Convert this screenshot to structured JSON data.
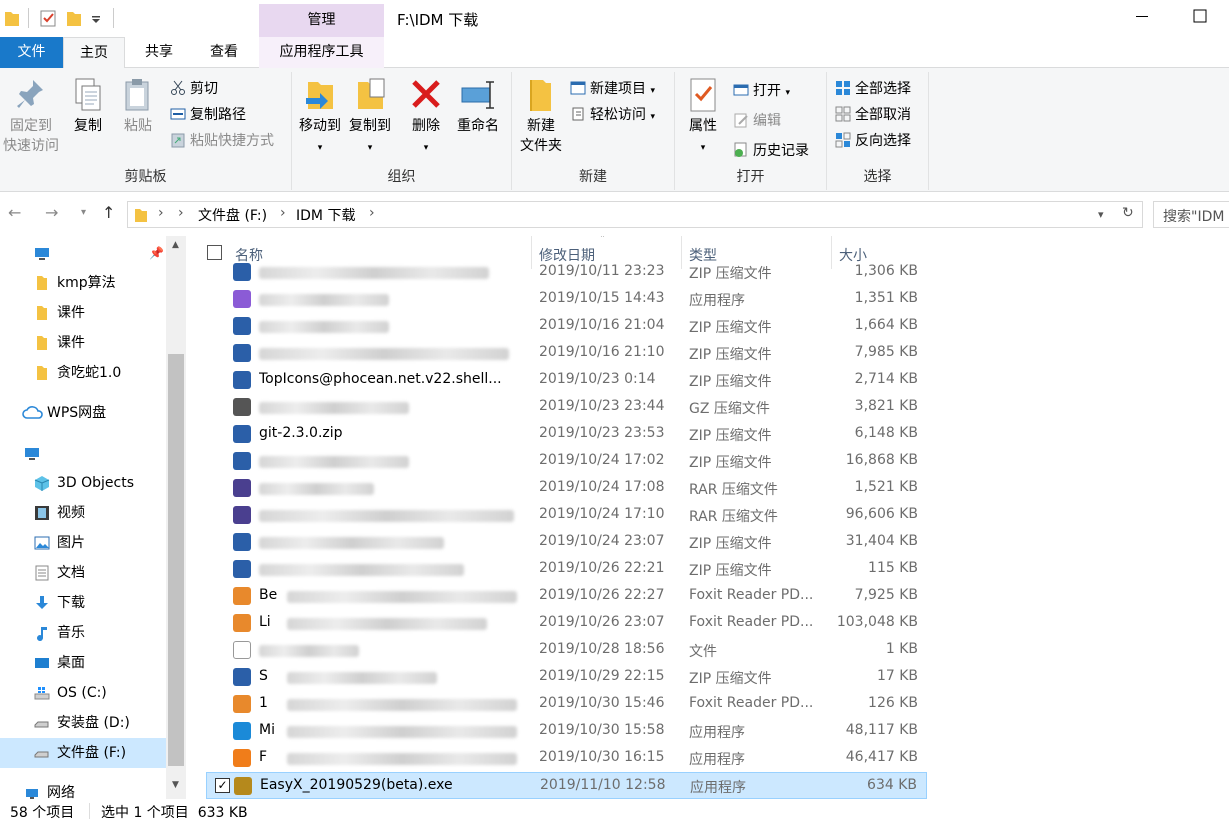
{
  "title": {
    "context_tab": "管理",
    "path": "F:\\IDM 下载"
  },
  "tabs": {
    "file": "文件",
    "home": "主页",
    "share": "共享",
    "view": "查看",
    "apptools": "应用程序工具"
  },
  "ribbon": {
    "clipboard": {
      "label": "剪贴板",
      "pin_line1": "固定到",
      "pin_line2": "快速访问",
      "copy": "复制",
      "paste": "粘贴",
      "cut": "剪切",
      "copy_path": "复制路径",
      "paste_shortcut": "粘贴快捷方式"
    },
    "organize": {
      "label": "组织",
      "move_to": "移动到",
      "copy_to": "复制到",
      "delete": "删除",
      "rename": "重命名"
    },
    "new": {
      "label": "新建",
      "new_folder_line1": "新建",
      "new_folder_line2": "文件夹",
      "new_item": "新建项目",
      "easy_access": "轻松访问"
    },
    "open": {
      "label": "打开",
      "properties": "属性",
      "open": "打开",
      "edit": "编辑",
      "history": "历史记录"
    },
    "select": {
      "label": "选择",
      "select_all": "全部选择",
      "select_none": "全部取消",
      "invert": "反向选择"
    }
  },
  "address": {
    "crumbs": [
      "文件盘 (F:)",
      "IDM 下载"
    ],
    "search_placeholder": "搜索\"IDM"
  },
  "nav": {
    "items": [
      "kmp算法",
      "课件",
      "课件",
      "贪吃蛇1.0",
      "WPS网盘",
      "3D Objects",
      "视频",
      "图片",
      "文档",
      "下载",
      "音乐",
      "桌面",
      "OS (C:)",
      "安装盘 (D:)",
      "文件盘 (F:)",
      "网络"
    ]
  },
  "columns": {
    "name": "名称",
    "date": "修改日期",
    "type": "类型",
    "size": "大小"
  },
  "files": [
    {
      "name": "",
      "date": "2019/10/11 23:23",
      "type": "ZIP 压缩文件",
      "size": "1,306 KB",
      "icon": "zip-icon"
    },
    {
      "name": "",
      "date": "2019/10/15 14:43",
      "type": "应用程序",
      "size": "1,351 KB",
      "icon": "vs-installer-icon"
    },
    {
      "name": "",
      "date": "2019/10/16 21:04",
      "type": "ZIP 压缩文件",
      "size": "1,664 KB",
      "icon": "zip-icon"
    },
    {
      "name": "",
      "date": "2019/10/16 21:10",
      "type": "ZIP 压缩文件",
      "size": "7,985 KB",
      "icon": "zip-icon"
    },
    {
      "name": "TopIcons@phocean.net.v22.shell...",
      "date": "2019/10/23 0:14",
      "type": "ZIP 压缩文件",
      "size": "2,714 KB",
      "icon": "zip-icon"
    },
    {
      "name": "",
      "date": "2019/10/23 23:44",
      "type": "GZ 压缩文件",
      "size": "3,821 KB",
      "icon": "gz-icon"
    },
    {
      "name": "git-2.3.0.zip",
      "date": "2019/10/23 23:53",
      "type": "ZIP 压缩文件",
      "size": "6,148 KB",
      "icon": "zip-icon"
    },
    {
      "name": "",
      "date": "2019/10/24 17:02",
      "type": "ZIP 压缩文件",
      "size": "16,868 KB",
      "icon": "zip-icon"
    },
    {
      "name": "",
      "date": "2019/10/24 17:08",
      "type": "RAR 压缩文件",
      "size": "1,521 KB",
      "icon": "rar-icon"
    },
    {
      "name": "",
      "date": "2019/10/24 17:10",
      "type": "RAR 压缩文件",
      "size": "96,606 KB",
      "icon": "rar-icon"
    },
    {
      "name": "",
      "date": "2019/10/24 23:07",
      "type": "ZIP 压缩文件",
      "size": "31,404 KB",
      "icon": "zip-icon"
    },
    {
      "name": "",
      "date": "2019/10/26 22:21",
      "type": "ZIP 压缩文件",
      "size": "115 KB",
      "icon": "zip-icon"
    },
    {
      "name": "Be",
      "date": "2019/10/26 22:27",
      "type": "Foxit Reader PD...",
      "size": "7,925 KB",
      "icon": "pdf-icon"
    },
    {
      "name": "Li",
      "date": "2019/10/26 23:07",
      "type": "Foxit Reader PD...",
      "size": "103,048 KB",
      "icon": "pdf-icon"
    },
    {
      "name": "",
      "date": "2019/10/28 18:56",
      "type": "文件",
      "size": "1 KB",
      "icon": "file-icon"
    },
    {
      "name": "S",
      "date": "2019/10/29 22:15",
      "type": "ZIP 压缩文件",
      "size": "17 KB",
      "icon": "zip-icon"
    },
    {
      "name": "1",
      "date": "2019/10/30 15:46",
      "type": "Foxit Reader PD...",
      "size": "126 KB",
      "icon": "pdf-icon"
    },
    {
      "name": "Mi",
      "date": "2019/10/30 15:58",
      "type": "应用程序",
      "size": "48,117 KB",
      "icon": "edge-icon"
    },
    {
      "name": "F",
      "date": "2019/10/30 16:15",
      "type": "应用程序",
      "size": "46,417 KB",
      "icon": "app-icon"
    },
    {
      "name": "EasyX_20190529(beta).exe",
      "date": "2019/11/10 12:58",
      "type": "应用程序",
      "size": "634 KB",
      "icon": "easyx-icon"
    }
  ],
  "status": {
    "count": "58 个项目",
    "selected": "选中 1 个项目  633 KB"
  }
}
